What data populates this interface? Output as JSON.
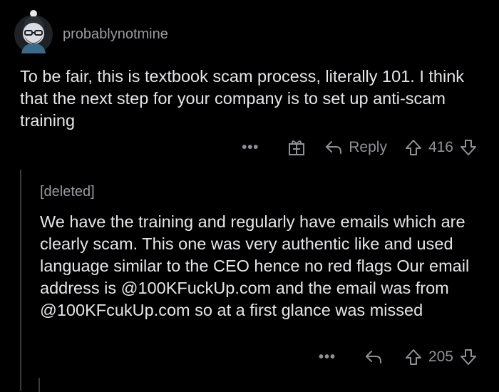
{
  "comment1": {
    "username": "probablynotmine",
    "text": "To be fair, this is textbook scam process, literally 101. I think that the next step for your company is to set up anti-scam training",
    "more_label": "•••",
    "reply_label": "Reply",
    "vote_count": "416"
  },
  "comment2": {
    "username": "[deleted]",
    "text": "We have the training and regularly have emails which are clearly scam. This one was very authentic like and used language similar to the CEO hence no red flags Our email address is @100KFuckUp.com and the email was from @100KFcukUp.com so at a first glance was missed",
    "more_label": "•••",
    "vote_count": "205"
  },
  "icons": {
    "avatar": "avatar-icon",
    "gift": "gift-icon",
    "reply": "reply-arrow-icon",
    "upvote": "upvote-arrow-icon",
    "downvote": "downvote-arrow-icon"
  },
  "colors": {
    "background": "#000000",
    "text": "#e4e6e8",
    "muted": "#9a9ca0",
    "thread_line": "#3a3c40"
  }
}
